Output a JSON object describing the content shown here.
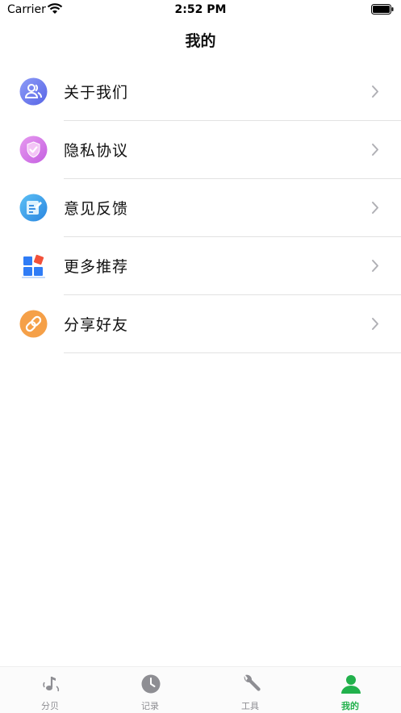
{
  "status_bar": {
    "carrier": "Carrier",
    "time": "2:52 PM"
  },
  "nav": {
    "title": "我的"
  },
  "menu": [
    {
      "label": "关于我们",
      "icon": "about-us-icon",
      "color": "#6f7cf0"
    },
    {
      "label": "隐私协议",
      "icon": "privacy-shield-icon",
      "color": "#d97de8"
    },
    {
      "label": "意见反馈",
      "icon": "feedback-edit-icon",
      "color": "#3aa0ea"
    },
    {
      "label": "更多推荐",
      "icon": "apps-grid-icon",
      "color": "#2f7cf6"
    },
    {
      "label": "分享好友",
      "icon": "link-share-icon",
      "color": "#f5a048"
    }
  ],
  "tabs": [
    {
      "label": "分贝",
      "icon": "music-note-icon",
      "active": false
    },
    {
      "label": "记录",
      "icon": "clock-icon",
      "active": false
    },
    {
      "label": "工具",
      "icon": "wrench-icon",
      "active": false
    },
    {
      "label": "我的",
      "icon": "person-icon",
      "active": true
    }
  ],
  "colors": {
    "active_tab": "#22b14c",
    "inactive_tab": "#8e8e93"
  }
}
